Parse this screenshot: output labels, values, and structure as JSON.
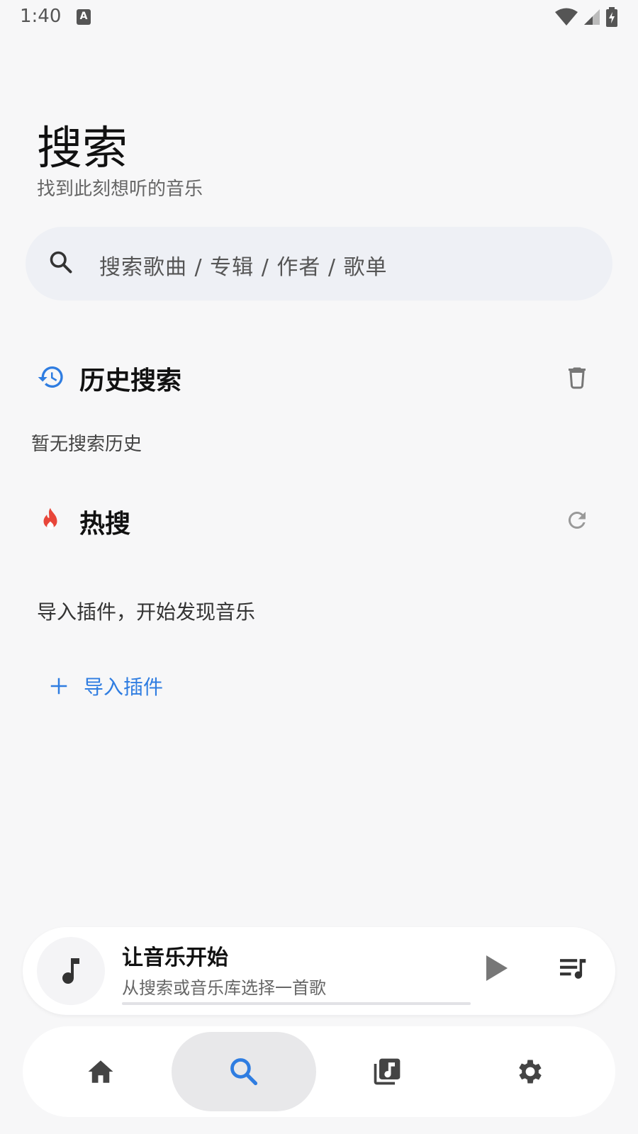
{
  "status_bar": {
    "time": "1:40",
    "notification_letter": "A"
  },
  "header": {
    "title": "搜索",
    "subtitle": "找到此刻想听的音乐"
  },
  "search": {
    "placeholder": "搜索歌曲 / 专辑 / 作者 / 歌单"
  },
  "history": {
    "title": "历史搜索",
    "empty_text": "暂无搜索历史"
  },
  "hot": {
    "title": "热搜",
    "hint": "导入插件，开始发现音乐",
    "import_label": "导入插件"
  },
  "mini_player": {
    "title": "让音乐开始",
    "subtitle": "从搜索或音乐库选择一首歌",
    "progress": 0
  },
  "bottom_nav": {
    "items": [
      {
        "icon": "home-icon",
        "active": false
      },
      {
        "icon": "search-icon",
        "active": true
      },
      {
        "icon": "library-icon",
        "active": false
      },
      {
        "icon": "settings-icon",
        "active": false
      }
    ]
  },
  "colors": {
    "accent": "#2f7de1",
    "hot": "#e8463a",
    "background": "#f7f7f8"
  }
}
